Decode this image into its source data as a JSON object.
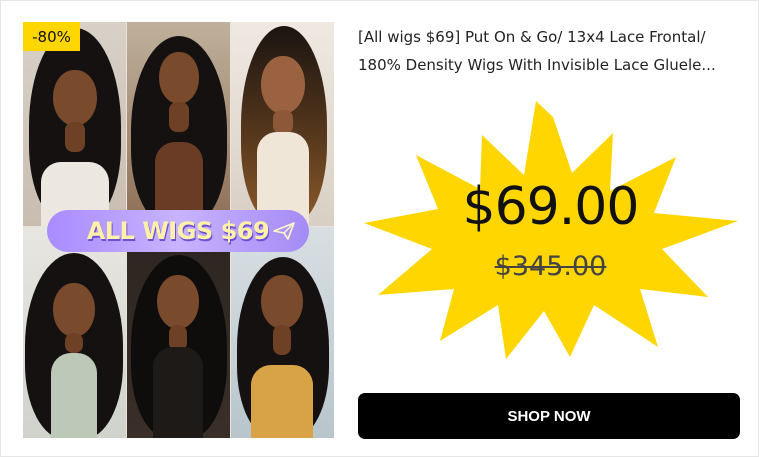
{
  "product": {
    "badge": "-80%",
    "title_line1": "[All wigs $69] Put On & Go/ 13x4 Lace Frontal/",
    "title_line2": "180% Density Wigs With Invisible Lace Gluele...",
    "price": "$69.00",
    "original_price": "$345.00",
    "banner_text": "ALL WIGS $69",
    "cta_label": "SHOP NOW"
  },
  "colors": {
    "badge": "#ffd600",
    "burst": "#ffd600",
    "button": "#000000",
    "banner": "#b39cff"
  },
  "icons": [
    "paper-plane-icon"
  ]
}
